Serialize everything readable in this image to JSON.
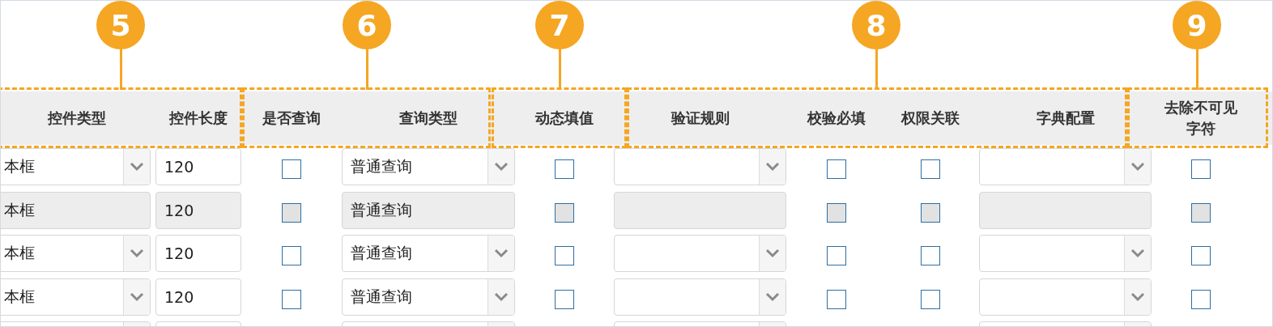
{
  "callouts": [
    {
      "number": "5"
    },
    {
      "number": "6"
    },
    {
      "number": "7"
    },
    {
      "number": "8"
    },
    {
      "number": "9"
    }
  ],
  "columns": [
    "控件类型",
    "控件长度",
    "是否查询",
    "查询类型",
    "动态填值",
    "验证规则",
    "校验必填",
    "权限关联",
    "字典配置",
    "去除不可见字符"
  ],
  "rows": [
    {
      "disabled": false,
      "cells": [
        {
          "kind": "select",
          "value": "本框"
        },
        {
          "kind": "input",
          "value": "120"
        },
        {
          "kind": "checkbox",
          "checked": false
        },
        {
          "kind": "select",
          "value": "普通查询"
        },
        {
          "kind": "checkbox",
          "checked": false
        },
        {
          "kind": "select"
        },
        {
          "kind": "checkbox",
          "checked": false
        },
        {
          "kind": "checkbox",
          "checked": false
        },
        {
          "kind": "select"
        },
        {
          "kind": "checkbox",
          "checked": false
        }
      ]
    },
    {
      "disabled": true,
      "cells": [
        {
          "kind": "select",
          "value": "本框"
        },
        {
          "kind": "input",
          "value": "120"
        },
        {
          "kind": "checkbox",
          "checked": false
        },
        {
          "kind": "select",
          "value": "普通查询"
        },
        {
          "kind": "checkbox",
          "checked": false
        },
        {
          "kind": "select"
        },
        {
          "kind": "checkbox",
          "checked": false
        },
        {
          "kind": "checkbox",
          "checked": false
        },
        {
          "kind": "select"
        },
        {
          "kind": "checkbox",
          "checked": false
        }
      ]
    },
    {
      "disabled": false,
      "cells": [
        {
          "kind": "select",
          "value": "本框"
        },
        {
          "kind": "input",
          "value": "120"
        },
        {
          "kind": "checkbox",
          "checked": false
        },
        {
          "kind": "select",
          "value": "普通查询"
        },
        {
          "kind": "checkbox",
          "checked": false
        },
        {
          "kind": "select"
        },
        {
          "kind": "checkbox",
          "checked": false
        },
        {
          "kind": "checkbox",
          "checked": false
        },
        {
          "kind": "select"
        },
        {
          "kind": "checkbox",
          "checked": false
        }
      ]
    },
    {
      "disabled": false,
      "cells": [
        {
          "kind": "select",
          "value": "本框"
        },
        {
          "kind": "input",
          "value": "120"
        },
        {
          "kind": "checkbox",
          "checked": false
        },
        {
          "kind": "select",
          "value": "普通查询"
        },
        {
          "kind": "checkbox",
          "checked": false
        },
        {
          "kind": "select"
        },
        {
          "kind": "checkbox",
          "checked": false
        },
        {
          "kind": "checkbox",
          "checked": false
        },
        {
          "kind": "select"
        },
        {
          "kind": "checkbox",
          "checked": false
        }
      ]
    },
    {
      "disabled": false,
      "cells": [
        {
          "kind": "select_top"
        },
        {
          "kind": "input_top"
        },
        {
          "kind": "empty"
        },
        {
          "kind": "select_top"
        },
        {
          "kind": "empty"
        },
        {
          "kind": "select_top"
        },
        {
          "kind": "empty"
        },
        {
          "kind": "empty"
        },
        {
          "kind": "select_top"
        },
        {
          "kind": "empty"
        }
      ]
    }
  ]
}
